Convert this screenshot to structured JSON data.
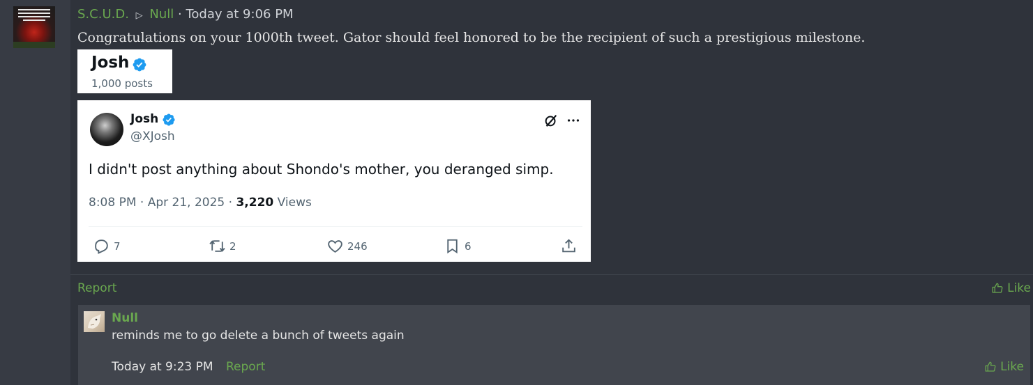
{
  "post": {
    "author": "S.C.U.D.",
    "arrow": "▷",
    "recipient": "Null",
    "separator": "·",
    "timestamp": "Today at 9:06 PM",
    "message": "Congratulations on your 1000th tweet. Gator should feel honored to be the recipient of such a prestigious milestone.",
    "report_label": "Report",
    "like_label": "Like"
  },
  "profile_card": {
    "name": "Josh",
    "posts": "1,000 posts"
  },
  "tweet": {
    "name": "Josh",
    "handle": "@XJosh",
    "text": "I didn't post anything about Shondo's mother, you deranged simp.",
    "time": "8:08 PM",
    "date": "Apr 21, 2025",
    "views_count": "3,220",
    "views_label": "Views",
    "dot": "·",
    "replies": "7",
    "retweets": "2",
    "likes": "246",
    "bookmarks": "6"
  },
  "reply": {
    "author": "Null",
    "text": "reminds me to go delete a bunch of tweets again",
    "timestamp": "Today at 9:23 PM",
    "report_label": "Report",
    "like_label": "Like"
  },
  "colors": {
    "background": "#2f333b",
    "accent_green": "#6aa84f",
    "verified_blue": "#1d9bf0",
    "reply_background": "#41454d"
  }
}
